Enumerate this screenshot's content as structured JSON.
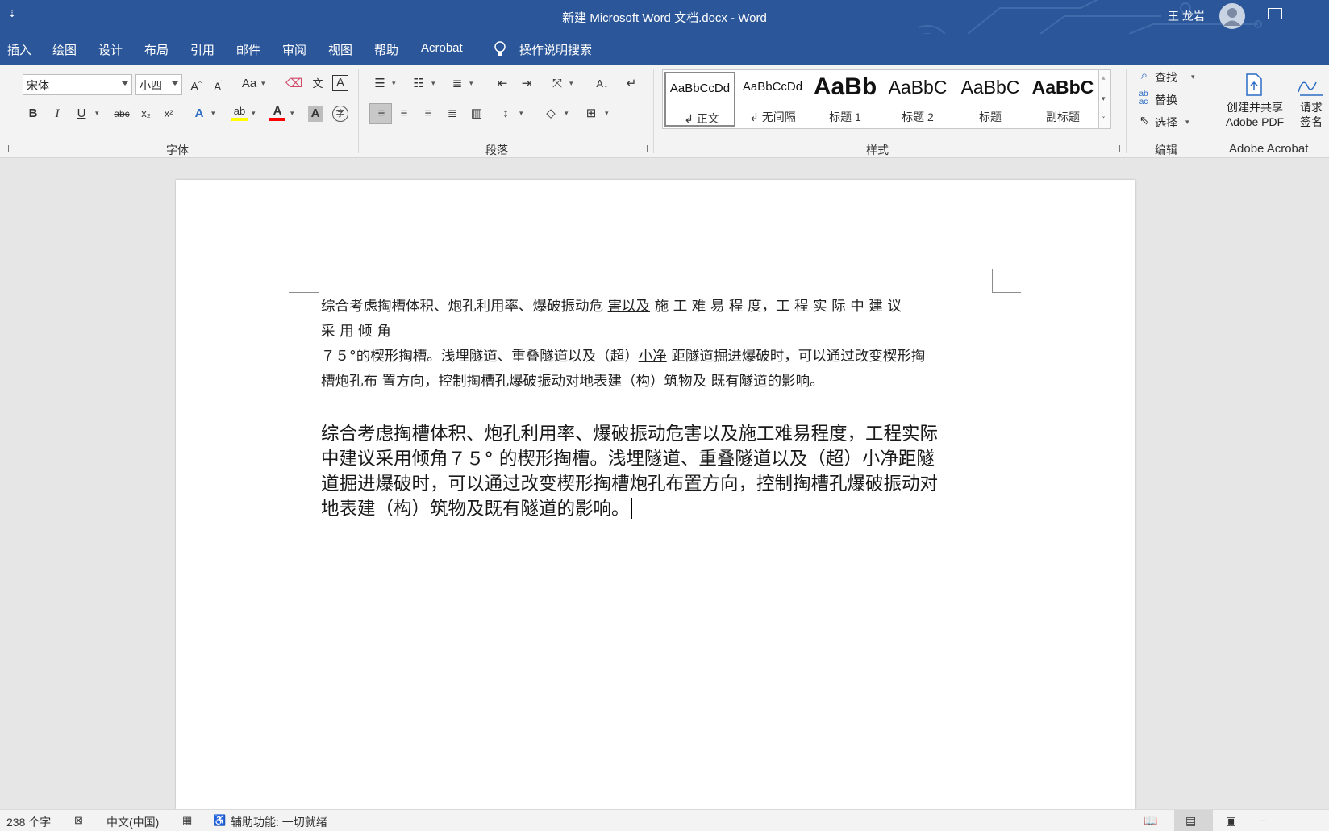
{
  "titlebar": {
    "qat": "⇣",
    "title": "新建 Microsoft Word 文档.docx  -  Word",
    "user": "王 龙岩"
  },
  "tabs": [
    "插入",
    "绘图",
    "设计",
    "布局",
    "引用",
    "邮件",
    "审阅",
    "视图",
    "帮助",
    "Acrobat"
  ],
  "tell_me": "操作说明搜索",
  "font": {
    "name": "宋体",
    "size": "小四",
    "group_label": "字体",
    "aa_label": "Aa",
    "bold": "B",
    "italic": "I",
    "underline": "U",
    "strike": "abc",
    "subscript": "x₂",
    "superscript": "x²",
    "color_a": "A"
  },
  "paragraph": {
    "group_label": "段落"
  },
  "styles": {
    "group_label": "样式",
    "items": [
      {
        "sample": "AaBbCcDd",
        "name": "↲ 正文"
      },
      {
        "sample": "AaBbCcDd",
        "name": "↲ 无间隔"
      },
      {
        "sample": "AaBb",
        "name": "标题 1"
      },
      {
        "sample": "AaBbC",
        "name": "标题 2"
      },
      {
        "sample": "AaBbC",
        "name": "标题"
      },
      {
        "sample": "AaBbC",
        "name": "副标题"
      }
    ]
  },
  "editing": {
    "group_label": "编辑",
    "find": "查找",
    "replace": "替换",
    "select": "选择"
  },
  "acrobat": {
    "create_line1": "创建并共享",
    "create_line2": "Adobe PDF",
    "request_line1": "请求",
    "request_line2": "签名",
    "group_label": "Adobe Acrobat"
  },
  "doc": {
    "small_para": {
      "line1_a": "综合考虑掏槽体积、炮孔利用率、爆破振动危 ",
      "line1_u": "害以及",
      "line1_b": " 施 工 难 易 程 度，工 程 实 际 中 建 议",
      "line2": "采 用 倾 角",
      "line3_a": "７５°的楔形掏槽。浅埋隧道、重叠隧道以及（超）",
      "line3_u": "小净",
      "line3_b": " 距隧道掘进爆破时，可以通过改变楔形掏",
      "line4": "槽炮孔布 置方向，控制掏槽孔爆破振动对地表建（构）筑物及 既有隧道的影响。"
    },
    "big_para": {
      "line1": "综合考虑掏槽体积、炮孔利用率、爆破振动危害以及施工难易程度，工程实际",
      "line2": "中建议采用倾角７５° 的楔形掏槽。浅埋隧道、重叠隧道以及（超）小净距隧",
      "line3": "道掘进爆破时，可以通过改变楔形掏槽炮孔布置方向，控制掏槽孔爆破振动对",
      "line4": "地表建（构）筑物及既有隧道的影响。"
    }
  },
  "status": {
    "word_count": "238 个字",
    "language": "中文(中国)",
    "accessibility": "辅助功能: 一切就绪"
  },
  "colors": {
    "titlebar": "#2b579a",
    "ribbon": "#f3f3f3",
    "canvas": "#e6e6e6",
    "highlight_yellow": "#ffff00",
    "font_red": "#ff0000"
  }
}
